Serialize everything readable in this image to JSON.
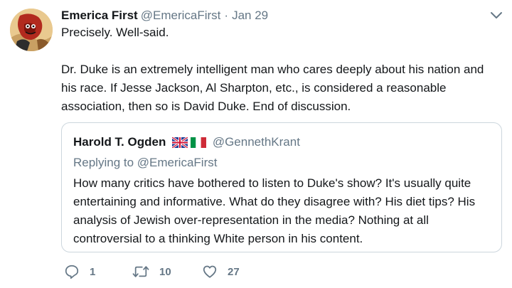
{
  "tweet": {
    "author": {
      "display_name": "Emerica First",
      "handle": "@EmericaFirst",
      "avatar_icon": "cartoon-avatar"
    },
    "separator": "·",
    "date": "Jan 29",
    "text_paragraphs": [
      "Precisely. Well-said.",
      "Dr. Duke is an extremely intelligent man who cares deeply about his nation and his race. If Jesse Jackson, Al Sharpton, etc., is considered a reasonable association, then so is David Duke. End of discussion."
    ],
    "menu_icon": "chevron-down-icon"
  },
  "quoted_tweet": {
    "display_name": "Harold T. Ogden",
    "flags": [
      "uk-flag",
      "italy-flag"
    ],
    "handle": "@GennethKrant",
    "replying_prefix": "Replying to",
    "replying_to": "@EmericaFirst",
    "text": "How many critics have bothered to listen to Duke's show? It's usually quite entertaining and informative. What do they disagree with? His diet tips? His analysis of Jewish over-representation in the media? Nothing at all controversial to a thinking White person in his content."
  },
  "actions": {
    "reply_count": "1",
    "retweet_count": "10",
    "like_count": "27"
  },
  "colors": {
    "text": "#14171a",
    "secondary": "#657786",
    "border": "#ccd6dd"
  }
}
